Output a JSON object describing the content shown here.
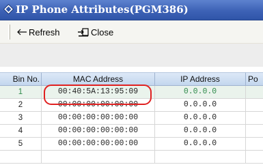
{
  "window": {
    "title": "IP Phone Attributes(PGM386)"
  },
  "toolbar": {
    "refresh_label": "Refresh",
    "close_label": "Close"
  },
  "table": {
    "headers": [
      "Bin No.",
      "MAC Address",
      "IP Address",
      "Po"
    ],
    "rows": [
      {
        "bin": "1",
        "mac": "00:40:5A:13:95:09",
        "ip": "0.0.0.0"
      },
      {
        "bin": "2",
        "mac": "00:00:00:00:00:00",
        "ip": "0.0.0.0"
      },
      {
        "bin": "3",
        "mac": "00:00:00:00:00:00",
        "ip": "0.0.0.0"
      },
      {
        "bin": "4",
        "mac": "00:00:00:00:00:00",
        "ip": "0.0.0.0"
      },
      {
        "bin": "5",
        "mac": "00:00:00:00:00:00",
        "ip": "0.0.0.0"
      }
    ]
  },
  "colors": {
    "title_bar": "#3d62b6",
    "highlight": "#e02020",
    "selected_text": "#2e8a4a"
  }
}
